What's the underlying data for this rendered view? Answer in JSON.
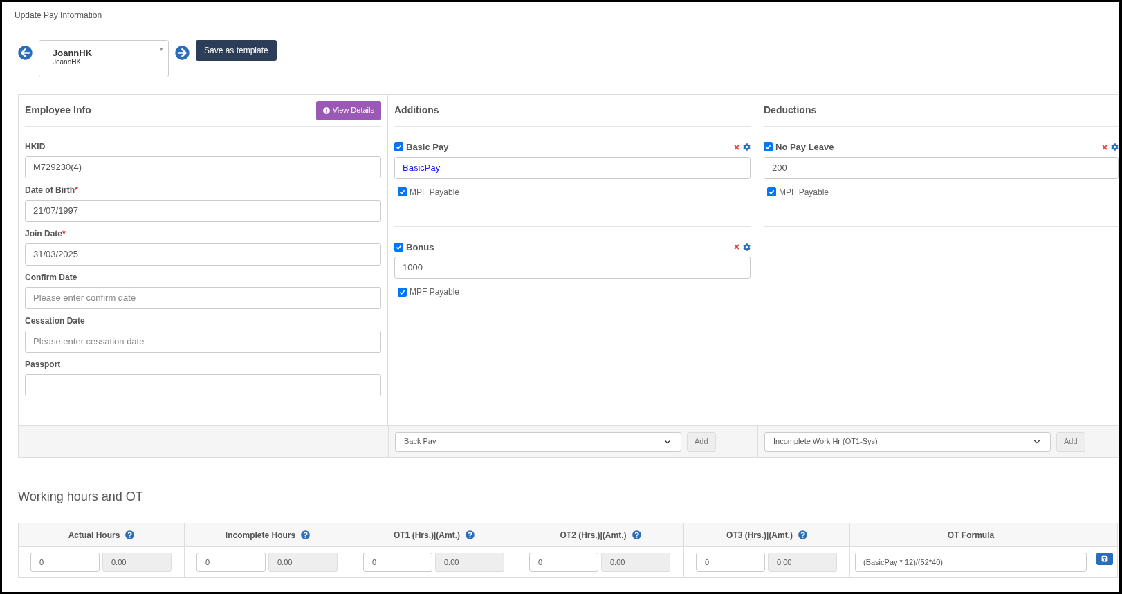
{
  "page_title": "Update Pay Information",
  "employee_picker": {
    "name": "JoannHK",
    "subtitle": "JoannHK"
  },
  "save_template_button": "Save as template",
  "employee_info": {
    "title": "Employee Info",
    "view_details_button": "View Details",
    "fields": [
      {
        "label": "HKID",
        "value": "M729230(4)"
      },
      {
        "label": "Date of Birth",
        "required_mark": "*",
        "value": "21/07/1997"
      },
      {
        "label": "Join Date",
        "required_mark": "*",
        "value": "31/03/2025"
      },
      {
        "label": "Confirm Date",
        "placeholder": "Please enter confirm date"
      },
      {
        "label": "Cessation Date",
        "placeholder": "Please enter cessation date"
      },
      {
        "label": "Passport"
      }
    ]
  },
  "additions": {
    "title": "Additions",
    "items": [
      {
        "name": "Basic Pay",
        "checked": true,
        "kind": "formula",
        "value": "BasicPay",
        "mpf_label": "MPF Payable",
        "mpf_checked": true
      },
      {
        "name": "Bonus",
        "checked": true,
        "kind": "amount",
        "value": "1000",
        "mpf_label": "MPF Payable",
        "mpf_checked": true
      }
    ],
    "select": "Back Pay",
    "add_button": "Add"
  },
  "deductions": {
    "title": "Deductions",
    "items": [
      {
        "name": "No Pay Leave",
        "checked": true,
        "kind": "amount",
        "value": "200",
        "mpf_label": "MPF Payable",
        "mpf_checked": true
      }
    ],
    "select": "Incomplete Work Hr (OT1-Sys)",
    "add_button": "Add"
  },
  "working_hours": {
    "title": "Working hours and OT",
    "columns": [
      {
        "label": "Actual Hours",
        "hours": "0",
        "amount": "0.00"
      },
      {
        "label": "Incomplete Hours",
        "hours": "0",
        "amount": "0.00"
      },
      {
        "label": "OT1 (Hrs.)|(Amt.)",
        "hours": "0",
        "amount": "0.00"
      },
      {
        "label": "OT2 (Hrs.)|(Amt.)",
        "hours": "0",
        "amount": "0.00"
      },
      {
        "label": "OT3 (Hrs.)|(Amt.)",
        "hours": "0",
        "amount": "0.00"
      }
    ],
    "formula_label": "OT Formula",
    "formula": "(BasicPay * 12)/(52*40)"
  }
}
